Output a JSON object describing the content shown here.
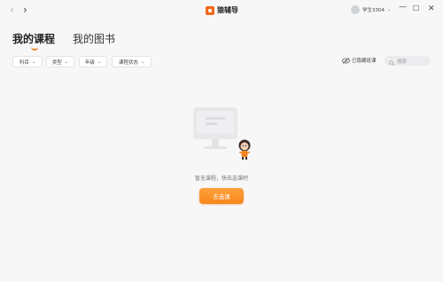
{
  "titlebar": {
    "back_icon": "‹",
    "forward_icon": "›",
    "app_name": "猿辅导",
    "user_name": "学生3304",
    "user_caret": "⌄",
    "minimize": "—",
    "maximize": "☐",
    "close": "✕"
  },
  "tabs": [
    {
      "label": "我的课程"
    },
    {
      "label": "我的图书"
    }
  ],
  "filters": [
    {
      "label": "科目"
    },
    {
      "label": "类型"
    },
    {
      "label": "年级"
    },
    {
      "label": "课程状态"
    }
  ],
  "filter_caret": "⌄",
  "toolbar": {
    "hidden_courses_label": "已隐藏班课",
    "search_placeholder": "搜索"
  },
  "empty_state": {
    "message": "暂无课程，快去选课吧",
    "button_label": "去选课"
  },
  "colors": {
    "accent": "#f5841f",
    "background": "#f7f7f8"
  }
}
